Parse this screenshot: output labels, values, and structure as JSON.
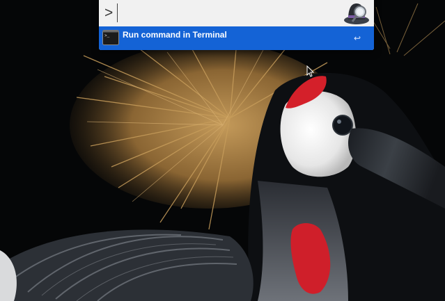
{
  "launcher": {
    "query": ">",
    "app_icon": "hat-magnifier-icon"
  },
  "results": [
    {
      "title": "Run command in Terminal",
      "icon": "terminal-icon",
      "hint_icon": "return-key-icon",
      "hint": "↩"
    }
  ],
  "colors": {
    "selection": "#1463d6",
    "launcher_bg": "#ececec"
  }
}
